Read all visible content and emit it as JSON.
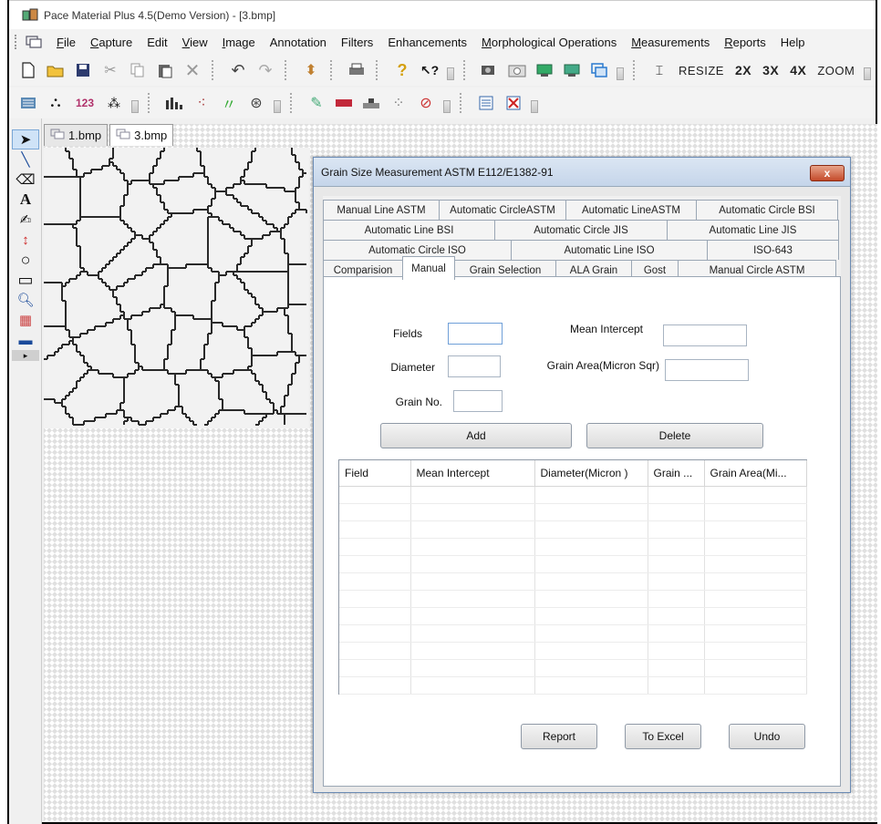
{
  "window": {
    "title": "Pace Material Plus 4.5(Demo Version) - [3.bmp]"
  },
  "menubar": [
    {
      "u": "F",
      "rest": "ile"
    },
    {
      "u": "C",
      "rest": "apture"
    },
    {
      "u": "",
      "rest": "Edit"
    },
    {
      "u": "V",
      "rest": "iew"
    },
    {
      "u": "I",
      "rest": "mage"
    },
    {
      "u": "",
      "rest": "Annotation"
    },
    {
      "u": "",
      "rest": "Filters"
    },
    {
      "u": "",
      "rest": "Enhancements"
    },
    {
      "u": "M",
      "rest": "orphological Operations"
    },
    {
      "u": "M",
      "rest": "easurements"
    },
    {
      "u": "R",
      "rest": "eports"
    },
    {
      "u": "",
      "rest": "Help"
    }
  ],
  "toolbar": {
    "resize": "RESIZE",
    "z2": "2X",
    "z3": "3X",
    "z4": "4X",
    "zoom": "ZOOM",
    "counter": "123"
  },
  "doctabs": [
    "1.bmp",
    "3.bmp"
  ],
  "dialog": {
    "title": "Grain Size Measurement ASTM E112/E1382-91",
    "close": "x",
    "tabs_row1": [
      "Manual Line ASTM",
      "Automatic CircleASTM",
      "Automatic LineASTM",
      "Automatic Circle BSI"
    ],
    "tabs_row2": [
      "Automatic Line BSI",
      "Automatic Circle JIS",
      "Automatic Line JIS"
    ],
    "tabs_row3": [
      "Automatic Circle ISO",
      "Automatic Line ISO",
      "ISO-643"
    ],
    "tabs_row4": [
      "Comparision",
      "Manual",
      "Grain Selection",
      "ALA Grain",
      "Gost",
      "Manual Circle ASTM"
    ],
    "active_tab": "Manual",
    "fields": {
      "fields_label": "Fields",
      "diameter_label": "Diameter",
      "grain_no_label": "Grain No.",
      "mean_intercept_label": "Mean Intercept",
      "grain_area_label": "Grain Area(Micron Sqr)",
      "fields_value": "",
      "diameter_value": "",
      "grain_no_value": "",
      "mean_intercept_value": "",
      "grain_area_value": ""
    },
    "buttons": {
      "add": "Add",
      "delete": "Delete",
      "report": "Report",
      "to_excel": "To Excel",
      "undo": "Undo"
    },
    "grid": {
      "columns": [
        "Field",
        "Mean Intercept",
        "Diameter(Micron )",
        "Grain ...",
        "Grain Area(Mi..."
      ],
      "rows": []
    }
  }
}
